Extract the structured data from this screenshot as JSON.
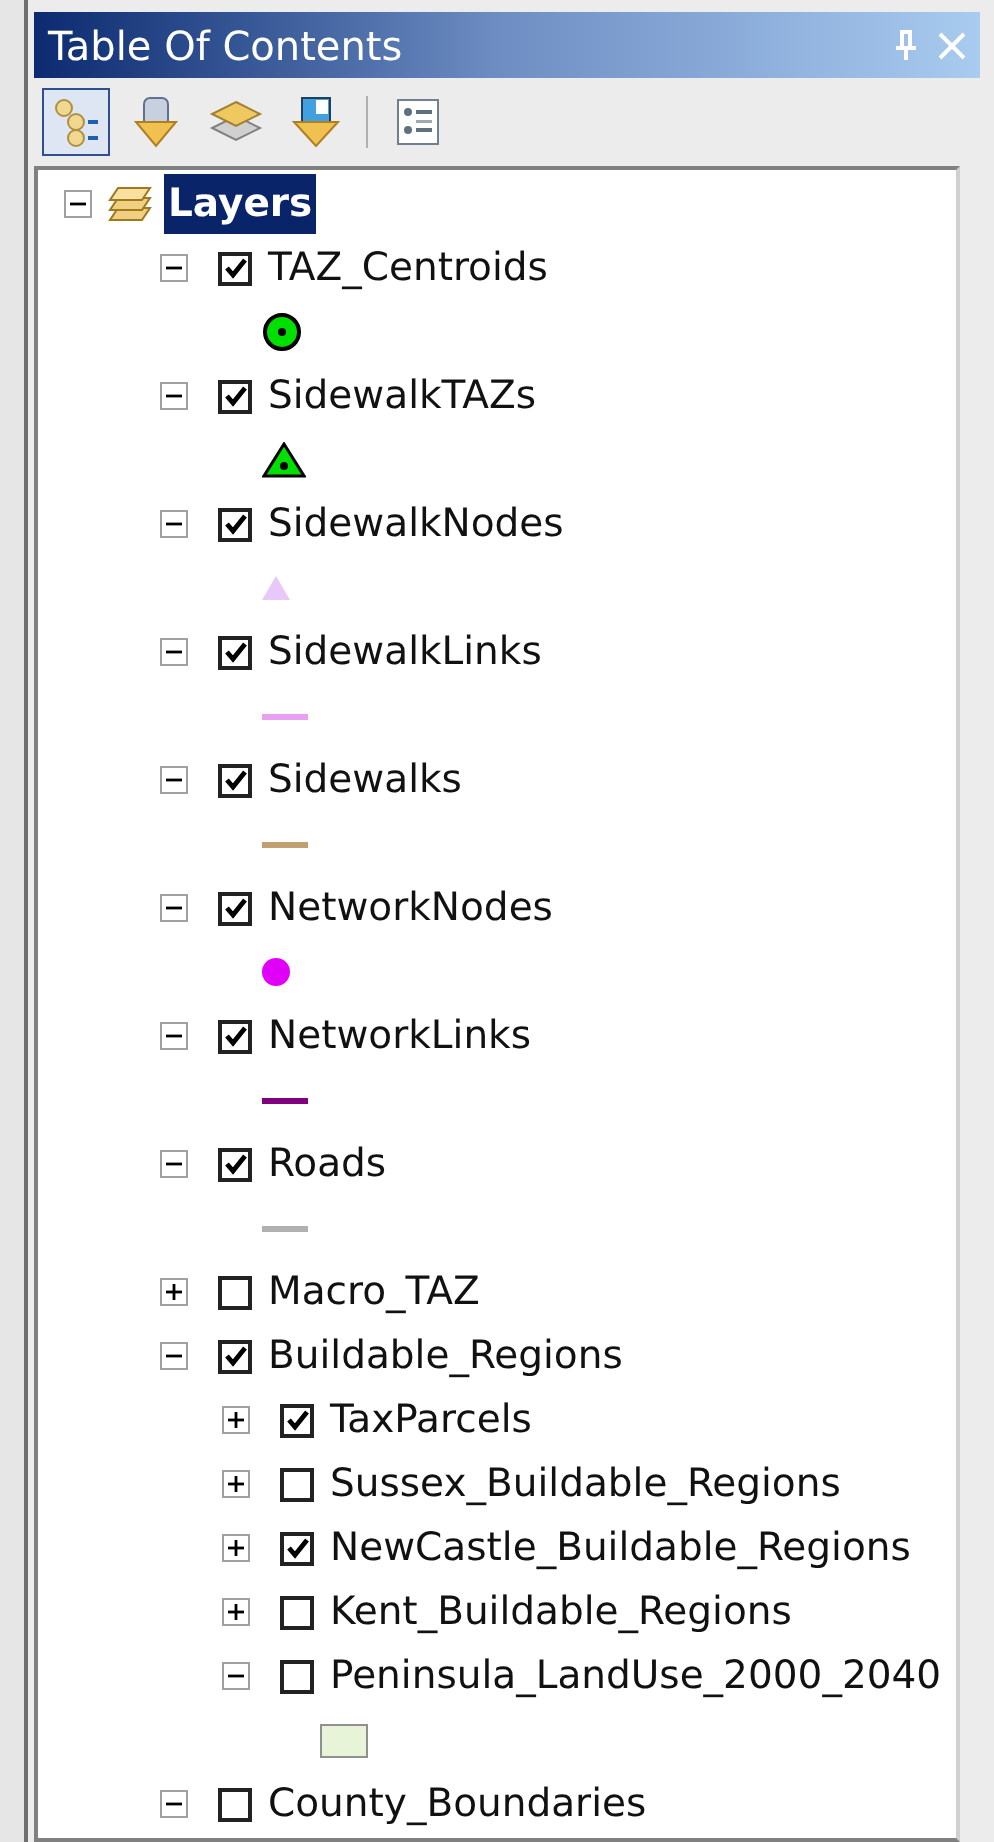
{
  "window": {
    "title": "Table Of Contents"
  },
  "toolbar": [
    {
      "kind": "drawing-order",
      "selected": true
    },
    {
      "kind": "source",
      "selected": false
    },
    {
      "kind": "visibility",
      "selected": false
    },
    {
      "kind": "selection",
      "selected": false
    },
    {
      "kind": "options",
      "selected": false
    }
  ],
  "tree": {
    "label": "Layers",
    "expanded": true,
    "selected": true,
    "children": [
      {
        "name": "TAZ_Centroids",
        "expanded": true,
        "checked": true,
        "symbol": {
          "kind": "ringed-dot",
          "color": "#00e000"
        }
      },
      {
        "name": "SidewalkTAZs",
        "expanded": true,
        "checked": true,
        "symbol": {
          "kind": "dotted-triangle",
          "color": "#00e000"
        }
      },
      {
        "name": "SidewalkNodes",
        "expanded": true,
        "checked": true,
        "symbol": {
          "kind": "triangle",
          "color": "#e8c8f8"
        }
      },
      {
        "name": "SidewalkLinks",
        "expanded": true,
        "checked": true,
        "symbol": {
          "kind": "line",
          "color": "#e8a0f0"
        }
      },
      {
        "name": "Sidewalks",
        "expanded": true,
        "checked": true,
        "symbol": {
          "kind": "line",
          "color": "#c0a070"
        }
      },
      {
        "name": "NetworkNodes",
        "expanded": true,
        "checked": true,
        "symbol": {
          "kind": "dot",
          "color": "#e000f8"
        }
      },
      {
        "name": "NetworkLinks",
        "expanded": true,
        "checked": true,
        "symbol": {
          "kind": "line",
          "color": "#800080"
        }
      },
      {
        "name": "Roads",
        "expanded": true,
        "checked": true,
        "symbol": {
          "kind": "line",
          "color": "#b0b0b0"
        }
      },
      {
        "name": "Macro_TAZ",
        "expanded": false,
        "checked": false
      },
      {
        "name": "Buildable_Regions",
        "expanded": true,
        "checked": true,
        "children": [
          {
            "name": "TaxParcels",
            "expanded": false,
            "checked": true
          },
          {
            "name": "Sussex_Buildable_Regions",
            "expanded": false,
            "checked": false
          },
          {
            "name": "NewCastle_Buildable_Regions",
            "expanded": false,
            "checked": true
          },
          {
            "name": "Kent_Buildable_Regions",
            "expanded": false,
            "checked": false
          },
          {
            "name": "Peninsula_LandUse_2000_2040",
            "expanded": true,
            "checked": false,
            "symbol": {
              "kind": "fill",
              "color": "#e8f4d8"
            }
          }
        ]
      },
      {
        "name": "County_Boundaries",
        "expanded": true,
        "checked": false
      }
    ]
  }
}
